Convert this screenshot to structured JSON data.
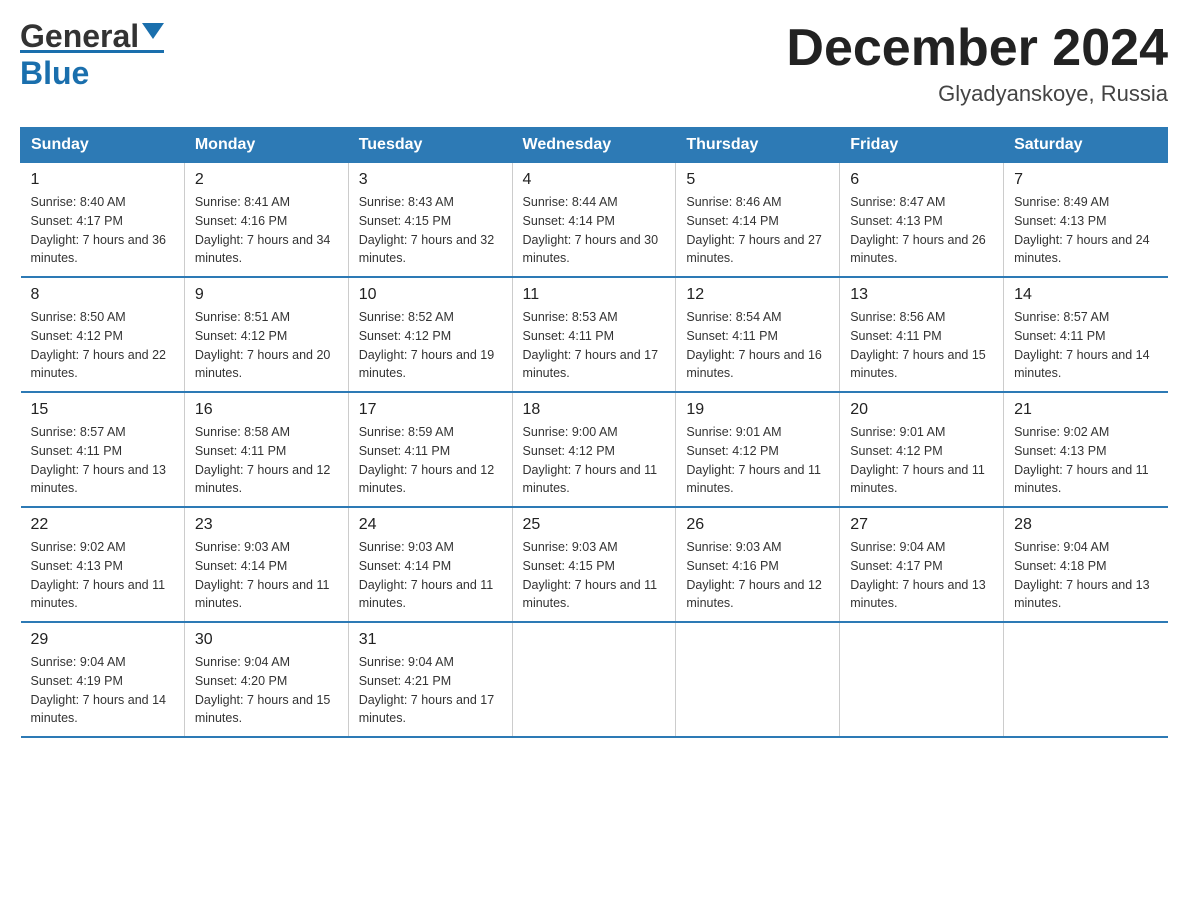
{
  "logo": {
    "part1": "General",
    "part2": "Blue"
  },
  "header": {
    "title": "December 2024",
    "location": "Glyadyanskoye, Russia"
  },
  "days_of_week": [
    "Sunday",
    "Monday",
    "Tuesday",
    "Wednesday",
    "Thursday",
    "Friday",
    "Saturday"
  ],
  "weeks": [
    [
      {
        "day": "1",
        "sunrise": "Sunrise: 8:40 AM",
        "sunset": "Sunset: 4:17 PM",
        "daylight": "Daylight: 7 hours and 36 minutes."
      },
      {
        "day": "2",
        "sunrise": "Sunrise: 8:41 AM",
        "sunset": "Sunset: 4:16 PM",
        "daylight": "Daylight: 7 hours and 34 minutes."
      },
      {
        "day": "3",
        "sunrise": "Sunrise: 8:43 AM",
        "sunset": "Sunset: 4:15 PM",
        "daylight": "Daylight: 7 hours and 32 minutes."
      },
      {
        "day": "4",
        "sunrise": "Sunrise: 8:44 AM",
        "sunset": "Sunset: 4:14 PM",
        "daylight": "Daylight: 7 hours and 30 minutes."
      },
      {
        "day": "5",
        "sunrise": "Sunrise: 8:46 AM",
        "sunset": "Sunset: 4:14 PM",
        "daylight": "Daylight: 7 hours and 27 minutes."
      },
      {
        "day": "6",
        "sunrise": "Sunrise: 8:47 AM",
        "sunset": "Sunset: 4:13 PM",
        "daylight": "Daylight: 7 hours and 26 minutes."
      },
      {
        "day": "7",
        "sunrise": "Sunrise: 8:49 AM",
        "sunset": "Sunset: 4:13 PM",
        "daylight": "Daylight: 7 hours and 24 minutes."
      }
    ],
    [
      {
        "day": "8",
        "sunrise": "Sunrise: 8:50 AM",
        "sunset": "Sunset: 4:12 PM",
        "daylight": "Daylight: 7 hours and 22 minutes."
      },
      {
        "day": "9",
        "sunrise": "Sunrise: 8:51 AM",
        "sunset": "Sunset: 4:12 PM",
        "daylight": "Daylight: 7 hours and 20 minutes."
      },
      {
        "day": "10",
        "sunrise": "Sunrise: 8:52 AM",
        "sunset": "Sunset: 4:12 PM",
        "daylight": "Daylight: 7 hours and 19 minutes."
      },
      {
        "day": "11",
        "sunrise": "Sunrise: 8:53 AM",
        "sunset": "Sunset: 4:11 PM",
        "daylight": "Daylight: 7 hours and 17 minutes."
      },
      {
        "day": "12",
        "sunrise": "Sunrise: 8:54 AM",
        "sunset": "Sunset: 4:11 PM",
        "daylight": "Daylight: 7 hours and 16 minutes."
      },
      {
        "day": "13",
        "sunrise": "Sunrise: 8:56 AM",
        "sunset": "Sunset: 4:11 PM",
        "daylight": "Daylight: 7 hours and 15 minutes."
      },
      {
        "day": "14",
        "sunrise": "Sunrise: 8:57 AM",
        "sunset": "Sunset: 4:11 PM",
        "daylight": "Daylight: 7 hours and 14 minutes."
      }
    ],
    [
      {
        "day": "15",
        "sunrise": "Sunrise: 8:57 AM",
        "sunset": "Sunset: 4:11 PM",
        "daylight": "Daylight: 7 hours and 13 minutes."
      },
      {
        "day": "16",
        "sunrise": "Sunrise: 8:58 AM",
        "sunset": "Sunset: 4:11 PM",
        "daylight": "Daylight: 7 hours and 12 minutes."
      },
      {
        "day": "17",
        "sunrise": "Sunrise: 8:59 AM",
        "sunset": "Sunset: 4:11 PM",
        "daylight": "Daylight: 7 hours and 12 minutes."
      },
      {
        "day": "18",
        "sunrise": "Sunrise: 9:00 AM",
        "sunset": "Sunset: 4:12 PM",
        "daylight": "Daylight: 7 hours and 11 minutes."
      },
      {
        "day": "19",
        "sunrise": "Sunrise: 9:01 AM",
        "sunset": "Sunset: 4:12 PM",
        "daylight": "Daylight: 7 hours and 11 minutes."
      },
      {
        "day": "20",
        "sunrise": "Sunrise: 9:01 AM",
        "sunset": "Sunset: 4:12 PM",
        "daylight": "Daylight: 7 hours and 11 minutes."
      },
      {
        "day": "21",
        "sunrise": "Sunrise: 9:02 AM",
        "sunset": "Sunset: 4:13 PM",
        "daylight": "Daylight: 7 hours and 11 minutes."
      }
    ],
    [
      {
        "day": "22",
        "sunrise": "Sunrise: 9:02 AM",
        "sunset": "Sunset: 4:13 PM",
        "daylight": "Daylight: 7 hours and 11 minutes."
      },
      {
        "day": "23",
        "sunrise": "Sunrise: 9:03 AM",
        "sunset": "Sunset: 4:14 PM",
        "daylight": "Daylight: 7 hours and 11 minutes."
      },
      {
        "day": "24",
        "sunrise": "Sunrise: 9:03 AM",
        "sunset": "Sunset: 4:14 PM",
        "daylight": "Daylight: 7 hours and 11 minutes."
      },
      {
        "day": "25",
        "sunrise": "Sunrise: 9:03 AM",
        "sunset": "Sunset: 4:15 PM",
        "daylight": "Daylight: 7 hours and 11 minutes."
      },
      {
        "day": "26",
        "sunrise": "Sunrise: 9:03 AM",
        "sunset": "Sunset: 4:16 PM",
        "daylight": "Daylight: 7 hours and 12 minutes."
      },
      {
        "day": "27",
        "sunrise": "Sunrise: 9:04 AM",
        "sunset": "Sunset: 4:17 PM",
        "daylight": "Daylight: 7 hours and 13 minutes."
      },
      {
        "day": "28",
        "sunrise": "Sunrise: 9:04 AM",
        "sunset": "Sunset: 4:18 PM",
        "daylight": "Daylight: 7 hours and 13 minutes."
      }
    ],
    [
      {
        "day": "29",
        "sunrise": "Sunrise: 9:04 AM",
        "sunset": "Sunset: 4:19 PM",
        "daylight": "Daylight: 7 hours and 14 minutes."
      },
      {
        "day": "30",
        "sunrise": "Sunrise: 9:04 AM",
        "sunset": "Sunset: 4:20 PM",
        "daylight": "Daylight: 7 hours and 15 minutes."
      },
      {
        "day": "31",
        "sunrise": "Sunrise: 9:04 AM",
        "sunset": "Sunset: 4:21 PM",
        "daylight": "Daylight: 7 hours and 17 minutes."
      },
      null,
      null,
      null,
      null
    ]
  ],
  "colors": {
    "header_bg": "#2d7ab5",
    "header_text": "#ffffff",
    "border": "#2d7ab5",
    "logo_blue": "#1a6fad"
  }
}
